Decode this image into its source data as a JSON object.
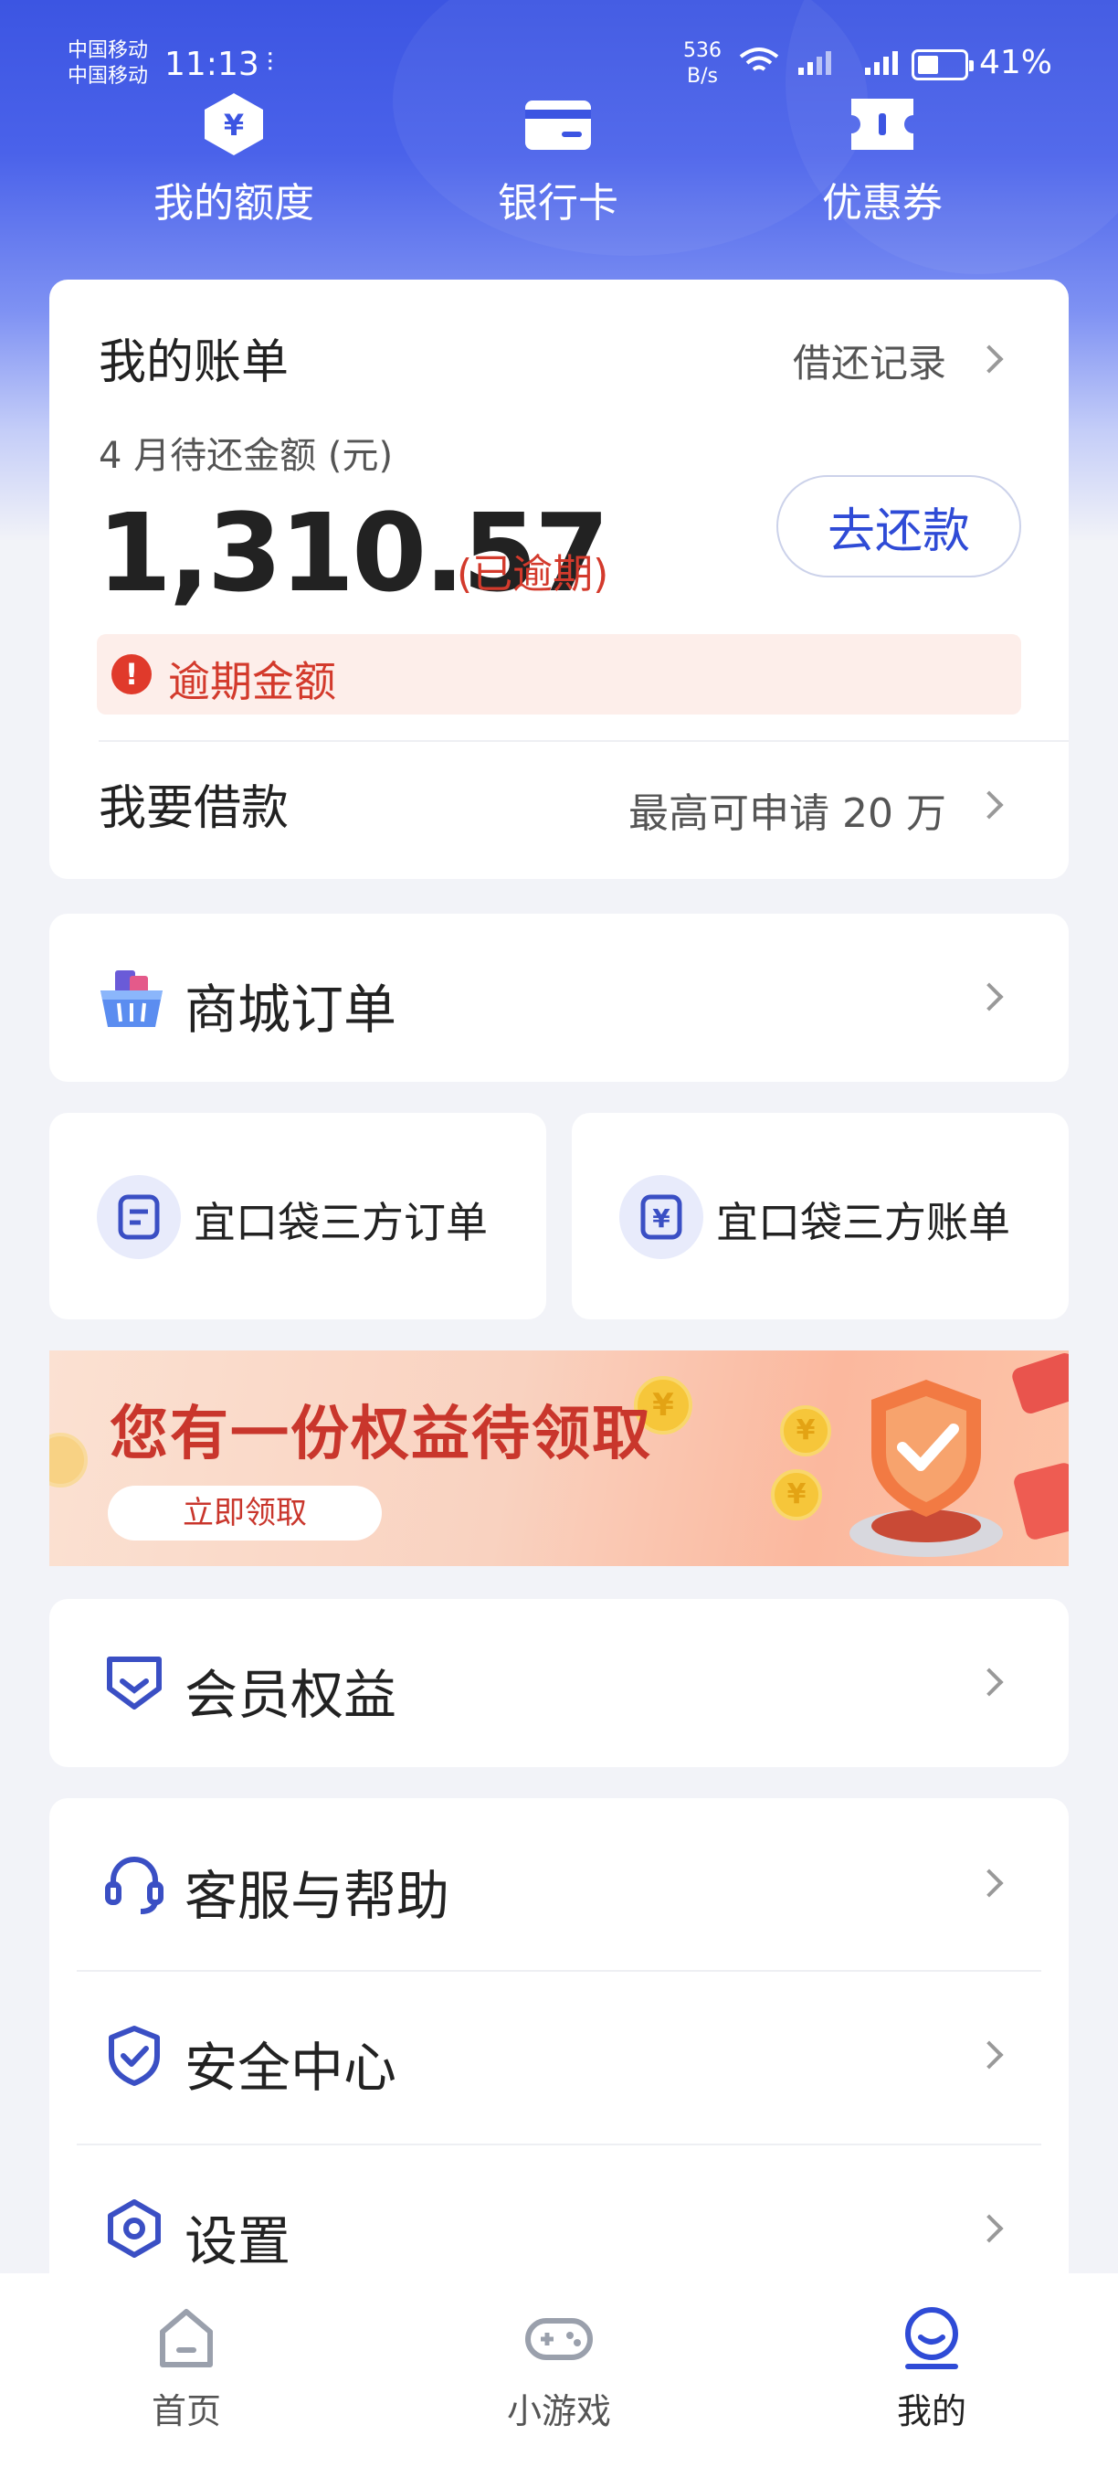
{
  "status_bar": {
    "carrier_1": "中国移动",
    "carrier_2": "中国移动",
    "time": "11:13",
    "net_speed_value": "536",
    "net_speed_unit": "B/s",
    "battery": "41%"
  },
  "top_nav": [
    {
      "label": "我的额度",
      "icon": "yuan-shield-icon"
    },
    {
      "label": "银行卡",
      "icon": "bank-card-icon"
    },
    {
      "label": "优惠券",
      "icon": "coupon-icon"
    }
  ],
  "bill": {
    "title": "我的账单",
    "history_link": "借还记录",
    "due_label": "4 月待还金额 (元)",
    "amount": "1,310.57",
    "overdue_tag": "(已逾期)",
    "repay_button": "去还款",
    "overdue_notice": "逾期金额"
  },
  "loan": {
    "title": "我要借款",
    "subtitle": "最高可申请 20 万"
  },
  "mall_orders": {
    "label": "商城订单",
    "icon": "shopping-basket-icon"
  },
  "third_party": [
    {
      "label": "宜口袋三方订单",
      "icon": "order-doc-icon"
    },
    {
      "label": "宜口袋三方账单",
      "icon": "yuan-bill-icon"
    }
  ],
  "banner": {
    "title": "您有一份权益待领取",
    "button": "立即领取",
    "coin_symbol": "¥"
  },
  "membership": {
    "label": "会员权益",
    "icon": "member-badge-icon"
  },
  "menu": [
    {
      "label": "客服与帮助",
      "icon": "headset-icon"
    },
    {
      "label": "安全中心",
      "icon": "shield-check-icon"
    },
    {
      "label": "设置",
      "icon": "settings-hex-icon"
    }
  ],
  "tab_bar": [
    {
      "label": "首页",
      "icon": "home-icon",
      "active": false
    },
    {
      "label": "小游戏",
      "icon": "gamepad-icon",
      "active": false
    },
    {
      "label": "我的",
      "icon": "profile-icon",
      "active": true
    }
  ],
  "colors": {
    "brand_blue": "#3c55e2",
    "alert_red": "#d33a2c",
    "icon_blue": "#3a4fc4"
  }
}
